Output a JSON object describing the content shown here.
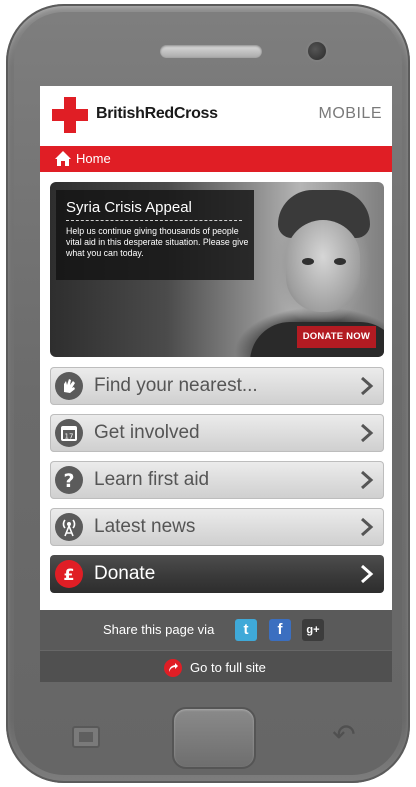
{
  "header": {
    "brand": "BritishRedCross",
    "mobile_label": "MOBILE"
  },
  "nav": {
    "home_label": "Home"
  },
  "banner": {
    "title": "Syria Crisis Appeal",
    "text": "Help us continue giving thousands of people vital aid in this desperate situation. Please give what you can today.",
    "cta": "DONATE NOW"
  },
  "menu": [
    {
      "label": "Find your nearest...",
      "icon": "hand-icon"
    },
    {
      "label": "Get involved",
      "icon": "calendar-icon"
    },
    {
      "label": "Learn first aid",
      "icon": "question-icon"
    },
    {
      "label": "Latest news",
      "icon": "broadcast-icon"
    },
    {
      "label": "Donate",
      "icon": "pound-icon"
    }
  ],
  "share": {
    "label": "Share this page via",
    "twitter": "t",
    "facebook": "f",
    "googleplus": "g+"
  },
  "footer": {
    "full_site_label": "Go to full site"
  },
  "colors": {
    "brand_red": "#e01e25",
    "dark_grey": "#5a5a5a"
  }
}
